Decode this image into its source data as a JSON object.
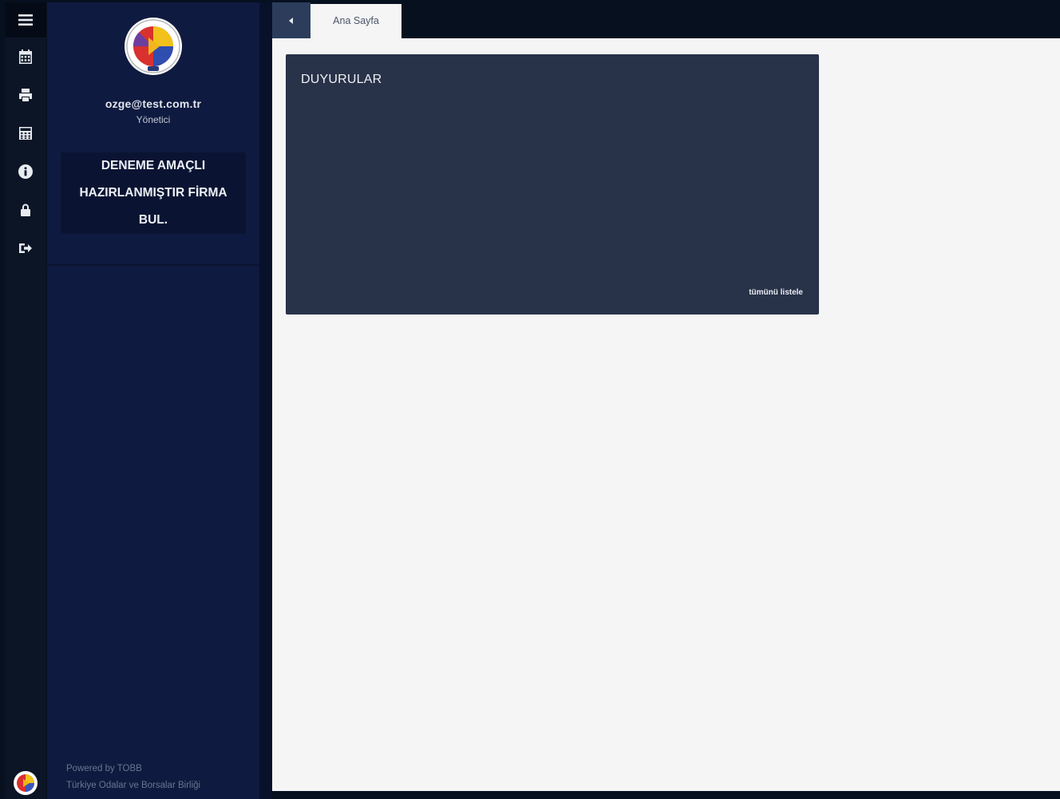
{
  "rail": {
    "items": [
      {
        "icon": "menu-icon"
      },
      {
        "icon": "calendar-icon"
      },
      {
        "icon": "print-icon"
      },
      {
        "icon": "calculator-icon"
      },
      {
        "icon": "info-icon"
      },
      {
        "icon": "lock-icon"
      },
      {
        "icon": "sign-out-icon"
      }
    ]
  },
  "sidebar": {
    "email": "ozge@test.com.tr",
    "role": "Yönetici",
    "company": "DENEME AMAÇLI HAZIRLANMIŞTIR FİRMA BUL.",
    "footer_line1": "Powered by TOBB",
    "footer_line2": "Türkiye Odalar ve Borsalar Birliği"
  },
  "topbar": {
    "tab_label": "Ana Sayfa"
  },
  "card": {
    "title": "DUYURULAR",
    "link": "tümünü listele"
  },
  "colors": {
    "rail_bg": "#0b1526",
    "sidebar_bg": "#0e1a3f",
    "card_bg": "#283248",
    "content_bg": "#f5f5f5",
    "back_button_bg": "#2c3d5c"
  }
}
